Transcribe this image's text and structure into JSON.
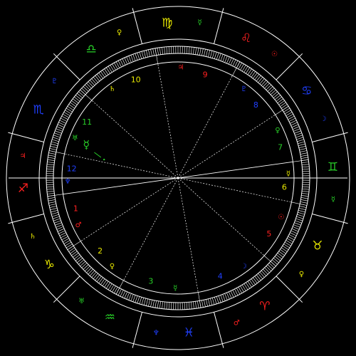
{
  "colors": {
    "background": "#000000",
    "lines": "#ffffff",
    "fire": "#ff2020",
    "earth": "#e8e800",
    "air": "#28d028",
    "water": "#2040ff"
  },
  "signs": [
    {
      "name": "virgo",
      "glyph": "♍",
      "color": "#e8e800"
    },
    {
      "name": "libra",
      "glyph": "♎",
      "color": "#28d028"
    },
    {
      "name": "scorpio",
      "glyph": "♏",
      "color": "#2040ff"
    },
    {
      "name": "sagittarius",
      "glyph": "♐",
      "color": "#ff2020"
    },
    {
      "name": "capricorn",
      "glyph": "♑",
      "color": "#e8e800"
    },
    {
      "name": "aquarius",
      "glyph": "♒",
      "color": "#28d028"
    },
    {
      "name": "pisces",
      "glyph": "♓",
      "color": "#2040ff"
    },
    {
      "name": "aries",
      "glyph": "♈",
      "color": "#ff2020"
    },
    {
      "name": "taurus",
      "glyph": "♉",
      "color": "#e8e800"
    },
    {
      "name": "gemini",
      "glyph": "♊",
      "color": "#28d028"
    },
    {
      "name": "cancer",
      "glyph": "♋",
      "color": "#2040ff"
    },
    {
      "name": "leo",
      "glyph": "♌",
      "color": "#ff2020"
    }
  ],
  "sign_rulers": [
    {
      "sign": "virgo",
      "glyph": "☿",
      "color": "#28d028"
    },
    {
      "sign": "libra",
      "glyph": "♀",
      "color": "#e8e800"
    },
    {
      "sign": "scorpio",
      "glyph": "♇",
      "color": "#2040ff"
    },
    {
      "sign": "sagittarius",
      "glyph": "♃",
      "color": "#ff2020"
    },
    {
      "sign": "capricorn",
      "glyph": "♄",
      "color": "#e8e800"
    },
    {
      "sign": "aquarius",
      "glyph": "♅",
      "color": "#28d028"
    },
    {
      "sign": "pisces",
      "glyph": "♆",
      "color": "#2040ff"
    },
    {
      "sign": "aries",
      "glyph": "♂",
      "color": "#ff2020"
    },
    {
      "sign": "taurus",
      "glyph": "♀",
      "color": "#e8e800"
    },
    {
      "sign": "gemini",
      "glyph": "☿",
      "color": "#28d028"
    },
    {
      "sign": "cancer",
      "glyph": "☽",
      "color": "#2040ff"
    },
    {
      "sign": "leo",
      "glyph": "☉",
      "color": "#ff2020"
    }
  ],
  "houses": [
    {
      "number": "1",
      "ruler": "♂",
      "color": "#ff2020"
    },
    {
      "number": "2",
      "ruler": "♀",
      "color": "#e8e800"
    },
    {
      "number": "3",
      "ruler": "☿",
      "color": "#28d028"
    },
    {
      "number": "4",
      "ruler": "☽",
      "color": "#2040ff"
    },
    {
      "number": "5",
      "ruler": "☉",
      "color": "#ff2020"
    },
    {
      "number": "6",
      "ruler": "☿",
      "color": "#e8e800"
    },
    {
      "number": "7",
      "ruler": "♀",
      "color": "#28d028"
    },
    {
      "number": "8",
      "ruler": "♇",
      "color": "#2040ff"
    },
    {
      "number": "9",
      "ruler": "♃",
      "color": "#ff2020"
    },
    {
      "number": "10",
      "ruler": "♄",
      "color": "#e8e800"
    },
    {
      "number": "11",
      "ruler": "♅",
      "color": "#28d028"
    },
    {
      "number": "12",
      "ruler": "♆",
      "color": "#2040ff"
    }
  ],
  "planets": [
    {
      "name": "mercury",
      "glyph": "☿",
      "color": "#28d028"
    }
  ]
}
